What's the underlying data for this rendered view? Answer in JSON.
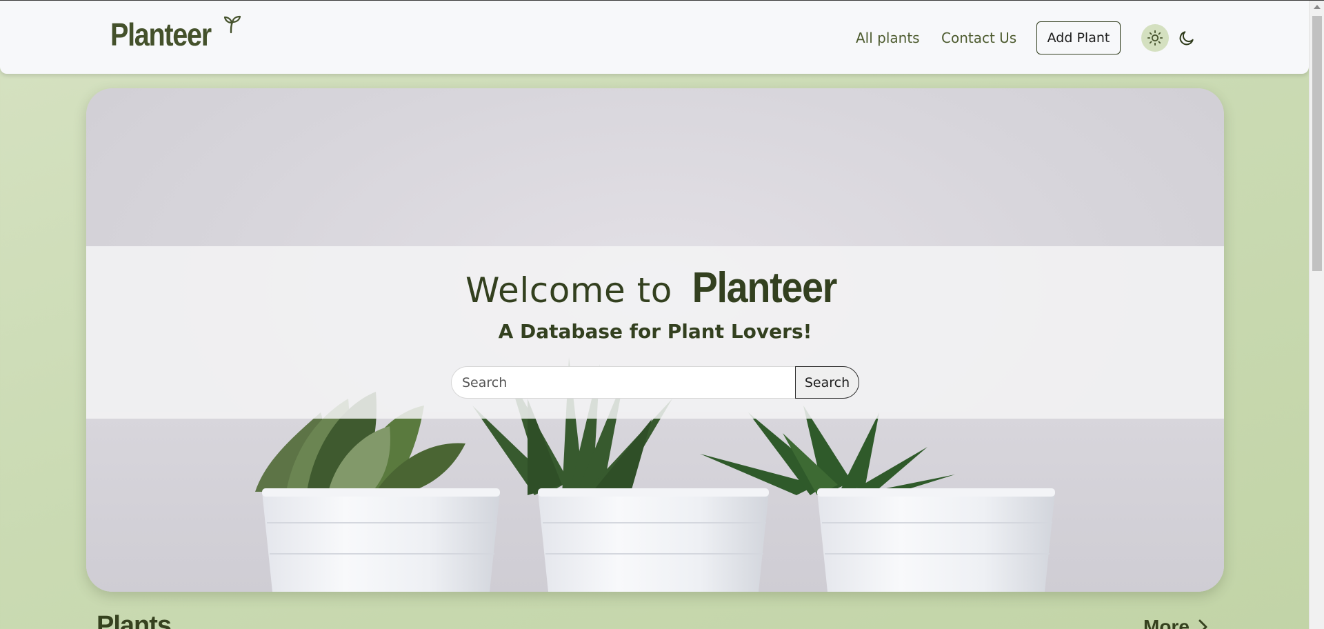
{
  "header": {
    "brand": "Planteer",
    "nav": {
      "all_plants": "All plants",
      "contact_us": "Contact Us"
    },
    "add_plant_label": "Add Plant"
  },
  "hero": {
    "welcome_text": "Welcome to",
    "brand_text": "Planteer",
    "subtitle": "A Database for Plant Lovers!",
    "search": {
      "placeholder": "Search",
      "value": "",
      "button_label": "Search"
    }
  },
  "plants_section": {
    "title": "Plants",
    "more_label": "More"
  },
  "colors": {
    "brand": "#44512b",
    "background": "#c9d9b2",
    "navbar": "#f7f8fa"
  },
  "icons": [
    "sprout-icon",
    "sun-icon",
    "moon-icon",
    "chevron-right-icon"
  ]
}
